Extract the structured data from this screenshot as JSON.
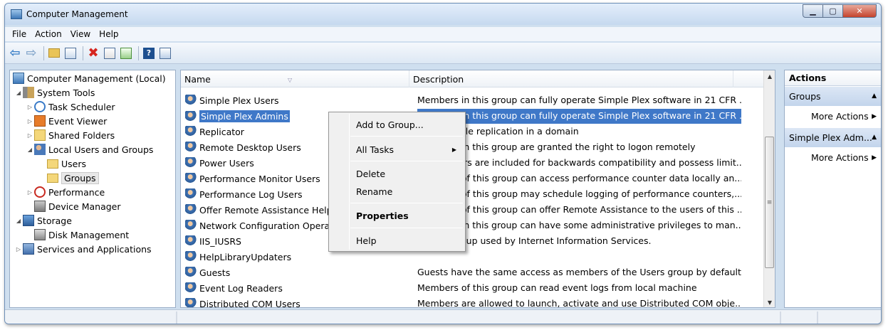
{
  "window": {
    "title": "Computer Management"
  },
  "menu": [
    "File",
    "Action",
    "View",
    "Help"
  ],
  "tree": [
    {
      "label": "Computer Management (Local)"
    },
    {
      "label": "System Tools"
    },
    {
      "label": "Task Scheduler"
    },
    {
      "label": "Event Viewer"
    },
    {
      "label": "Shared Folders"
    },
    {
      "label": "Local Users and Groups"
    },
    {
      "label": "Users"
    },
    {
      "label": "Groups"
    },
    {
      "label": "Performance"
    },
    {
      "label": "Device Manager"
    },
    {
      "label": "Storage"
    },
    {
      "label": "Disk Management"
    },
    {
      "label": "Services and Applications"
    }
  ],
  "list": {
    "columns": [
      "Name",
      "Description"
    ],
    "rows": [
      {
        "name": "Simple Plex Users",
        "desc": "Members in this group can fully operate Simple Plex software in 21 CFR ..."
      },
      {
        "name": "Simple Plex Admins",
        "desc": "Members in this group can fully operate Simple Plex software in 21 CFR ..."
      },
      {
        "name": "Replicator",
        "desc": "Supports file replication in a domain"
      },
      {
        "name": "Remote Desktop Users",
        "desc": "Members in this group are granted the right to logon remotely"
      },
      {
        "name": "Power Users",
        "desc": "Power Users are included for backwards compatibility and possess limit..."
      },
      {
        "name": "Performance Monitor Users",
        "desc": "Members of this group can access performance counter data locally an..."
      },
      {
        "name": "Performance Log Users",
        "desc": "Members of this group may schedule logging of performance counters,..."
      },
      {
        "name": "Offer Remote Assistance Helpers",
        "desc": "Members of this group can offer Remote Assistance to the users of this ..."
      },
      {
        "name": "Network Configuration Operators",
        "desc": "Members in this group can have some administrative privileges to man..."
      },
      {
        "name": "IIS_IUSRS",
        "desc": "Built-in group used by Internet Information Services."
      },
      {
        "name": "HelpLibraryUpdaters",
        "desc": ""
      },
      {
        "name": "Guests",
        "desc": "Guests have the same access as members of the Users group by default,..."
      },
      {
        "name": "Event Log Readers",
        "desc": "Members of this group can read event logs from local machine"
      },
      {
        "name": "Distributed COM Users",
        "desc": "Members are allowed to launch, activate and use Distributed COM obje..."
      }
    ]
  },
  "context_menu": {
    "add_to_group": "Add to Group...",
    "all_tasks": "All Tasks",
    "delete": "Delete",
    "rename": "Rename",
    "properties": "Properties",
    "help": "Help"
  },
  "actions": {
    "title": "Actions",
    "section1": "Groups",
    "more1": "More Actions",
    "section2": "Simple Plex Adm...",
    "more2": "More Actions"
  }
}
